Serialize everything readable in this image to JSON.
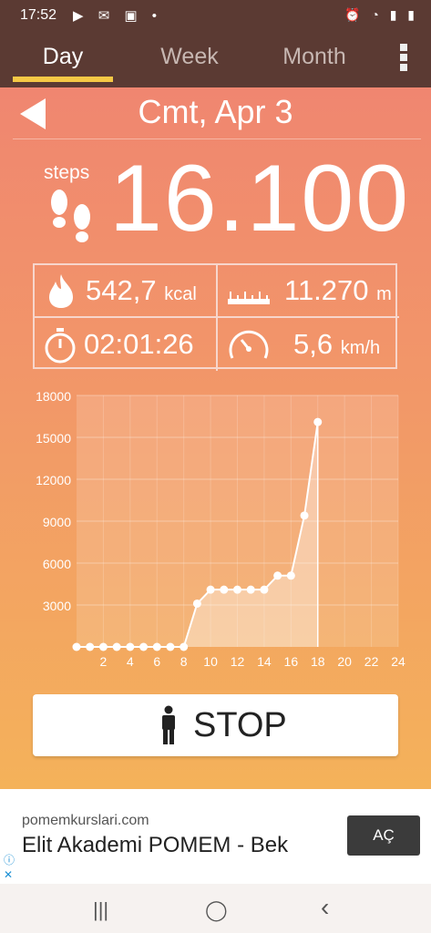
{
  "status_bar": {
    "time": "17:52",
    "notif_icons": "▶ ✉ ▣ •",
    "right_icons": "⏰ ◔ ▮ ▮"
  },
  "tabs": [
    {
      "label": "Day"
    },
    {
      "label": "Week"
    },
    {
      "label": "Month"
    }
  ],
  "date": "Cmt, Apr 3",
  "steps": {
    "label": "steps",
    "value": "16.100"
  },
  "stats": {
    "calories": {
      "value": "542,7",
      "unit": "kcal"
    },
    "distance": {
      "value": "11.270",
      "unit": "m"
    },
    "duration": {
      "value": "02:01:26"
    },
    "speed": {
      "value": "5,6",
      "unit": "km/h"
    }
  },
  "chart_data": {
    "type": "area",
    "x": [
      0,
      1,
      2,
      3,
      4,
      5,
      6,
      7,
      8,
      9,
      10,
      11,
      12,
      13,
      14,
      15,
      16,
      17,
      18
    ],
    "y": [
      0,
      0,
      0,
      0,
      0,
      0,
      0,
      0,
      0,
      3100,
      4100,
      4100,
      4100,
      4100,
      4100,
      5100,
      5100,
      9400,
      16100
    ],
    "xlim": [
      0,
      24
    ],
    "ylim": [
      0,
      18000
    ],
    "x_ticks": [
      "2",
      "4",
      "6",
      "8",
      "10",
      "12",
      "14",
      "16",
      "18",
      "20",
      "22",
      "24"
    ],
    "y_ticks": [
      "3000",
      "6000",
      "9000",
      "12000",
      "15000",
      "18000"
    ],
    "grid": true,
    "colors": {
      "line": "#ffffff",
      "fill": "#ffffff"
    }
  },
  "stop_button": {
    "label": "STOP"
  },
  "ad": {
    "domain": "pomemkurslari.com",
    "title": "Elit Akademi POMEM - Bek",
    "cta": "AÇ",
    "info": "ⓘ\n✕"
  },
  "nav": {
    "recent": "|||",
    "home": "◯",
    "back": "‹"
  },
  "colors": {
    "status": "#5b3a33",
    "accent": "#f5c845",
    "grad_top": "#f08670",
    "grad_bottom": "#f4b25a"
  }
}
